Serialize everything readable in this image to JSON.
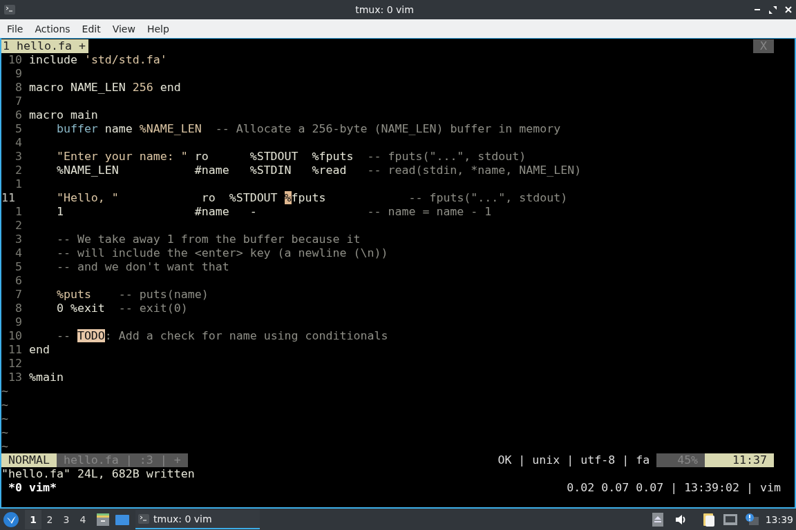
{
  "window": {
    "title": "tmux: 0 vim"
  },
  "menu": [
    {
      "label": "File"
    },
    {
      "label": "Actions"
    },
    {
      "label": "Edit"
    },
    {
      "label": "View"
    },
    {
      "label": "Help"
    }
  ],
  "editor": {
    "tabs": [
      {
        "label": "1 hello.fa +",
        "selected": true
      }
    ],
    "close_label": "X",
    "lines": [
      {
        "num": "10",
        "current": false,
        "segments": [
          {
            "kind": "plain",
            "text": "include "
          },
          {
            "kind": "string",
            "text": "'std/std.fa'"
          }
        ]
      },
      {
        "num": "9",
        "current": false
      },
      {
        "num": "8",
        "current": false,
        "segments": [
          {
            "kind": "plain",
            "text": "macro NAME_LEN "
          },
          {
            "kind": "string",
            "text": "256"
          },
          {
            "kind": "plain",
            "text": " end"
          }
        ]
      },
      {
        "num": "7",
        "current": false
      },
      {
        "num": "6",
        "current": false,
        "segments": [
          {
            "kind": "plain",
            "text": "macro main"
          }
        ]
      },
      {
        "num": "5",
        "current": false,
        "segments": [
          {
            "kind": "keyword",
            "text": "    buffer"
          },
          {
            "kind": "plain",
            "text": " name "
          },
          {
            "kind": "string",
            "text": "%NAME_LEN"
          },
          {
            "kind": "comment",
            "text": "  -- Allocate a 256-byte (NAME_LEN) buffer in memory"
          }
        ]
      },
      {
        "num": "4",
        "current": false
      },
      {
        "num": "3",
        "current": false,
        "segments": [
          {
            "kind": "string",
            "text": "    \"Enter your name: \""
          },
          {
            "kind": "plain",
            "text": " ro      %STDOUT  %fputs"
          },
          {
            "kind": "comment",
            "text": "  -- fputs(\"...\", stdout)"
          }
        ]
      },
      {
        "num": "2",
        "current": false,
        "segments": [
          {
            "kind": "plain",
            "text": "    %NAME_LEN           #name   %STDIN   %read"
          },
          {
            "kind": "comment",
            "text": "   -- read(stdin, *name, NAME_LEN)"
          }
        ]
      },
      {
        "num": "1",
        "current": false
      },
      {
        "num": "11",
        "current": true,
        "segments": [
          {
            "kind": "string",
            "text": "    \"Hello, \""
          },
          {
            "kind": "plain",
            "text": "            ro  %STDOUT "
          },
          {
            "kind": "cursor",
            "text": "%"
          },
          {
            "kind": "plain",
            "text": "fputs"
          },
          {
            "kind": "comment",
            "text": "            -- fputs(\"...\", stdout)"
          }
        ]
      },
      {
        "num": "1",
        "current": false,
        "segments": [
          {
            "kind": "plain",
            "text": "    1                   #name   -"
          },
          {
            "kind": "comment",
            "text": "                -- name = name - 1"
          }
        ]
      },
      {
        "num": "2",
        "current": false
      },
      {
        "num": "3",
        "current": false,
        "segments": [
          {
            "kind": "comment",
            "text": "    -- We take away 1 from the buffer because it"
          }
        ]
      },
      {
        "num": "4",
        "current": false,
        "segments": [
          {
            "kind": "comment",
            "text": "    -- will include the <enter> key (a newline (\\n))"
          }
        ]
      },
      {
        "num": "5",
        "current": false,
        "segments": [
          {
            "kind": "comment",
            "text": "    -- and we don't want that"
          }
        ]
      },
      {
        "num": "6",
        "current": false
      },
      {
        "num": "7",
        "current": false,
        "segments": [
          {
            "kind": "string",
            "text": "    %puts"
          },
          {
            "kind": "comment",
            "text": "    -- puts(name)"
          }
        ]
      },
      {
        "num": "8",
        "current": false,
        "segments": [
          {
            "kind": "plain",
            "text": "    0 %exit"
          },
          {
            "kind": "comment",
            "text": "  -- exit(0)"
          }
        ]
      },
      {
        "num": "9",
        "current": false
      },
      {
        "num": "10",
        "current": false,
        "segments": [
          {
            "kind": "comment",
            "text": "    -- "
          },
          {
            "kind": "todo",
            "text": "TODO"
          },
          {
            "kind": "comment",
            "text": ": Add a check for name using conditionals"
          }
        ]
      },
      {
        "num": "11",
        "current": false,
        "segments": [
          {
            "kind": "plain",
            "text": "end"
          }
        ]
      },
      {
        "num": "12",
        "current": false
      },
      {
        "num": "13",
        "current": false,
        "segments": [
          {
            "kind": "plain",
            "text": "%main"
          }
        ]
      }
    ],
    "tildes": [
      "~",
      "~",
      "~",
      "~",
      "~"
    ],
    "status_line": {
      "mode": "NORMAL",
      "file_info": "hello.fa | :3 | +",
      "file_format": "OK | unix | utf-8 | fa",
      "percent": "45%",
      "position": "11:37"
    },
    "message": "\"hello.fa\" 24L, 682B written"
  },
  "tmux_status": {
    "window": "*0 vim*",
    "right": "0.02 0.07 0.07 | 13:39:02 | vim"
  },
  "taskbar": {
    "workspaces": [
      {
        "label": "1",
        "selected": true
      },
      {
        "label": "2",
        "selected": false
      },
      {
        "label": "3",
        "selected": false
      },
      {
        "label": "4",
        "selected": false
      }
    ],
    "tasks": [
      {
        "label": "tmux: 0 vim",
        "selected": true
      }
    ],
    "clock": "13:39"
  }
}
